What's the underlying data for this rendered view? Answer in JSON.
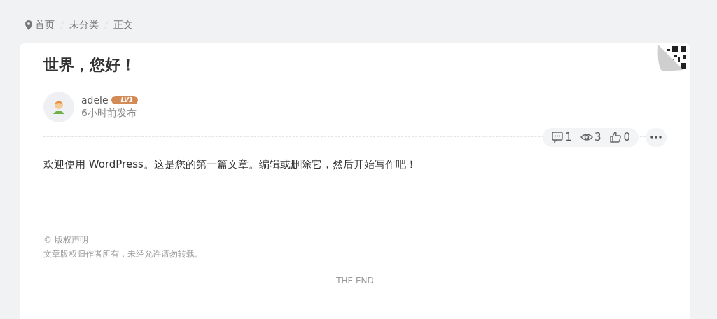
{
  "breadcrumb": [
    {
      "label": "首页"
    },
    {
      "label": "未分类"
    },
    {
      "label": "正文"
    }
  ],
  "post": {
    "title": "世界，您好！",
    "author": "adele",
    "level_badge": "LV1",
    "time": "6小时前发布",
    "stats": [
      {
        "kind": "comments",
        "count": "1"
      },
      {
        "kind": "views",
        "count": "3"
      },
      {
        "kind": "likes",
        "count": "0"
      }
    ],
    "content": "欢迎使用 WordPress。这是您的第一篇文章。编辑或删除它，然后开始写作吧！",
    "copyright_title": "© 版权声明",
    "copyright_text": "文章版权归作者所有，未经允许请勿转载。",
    "end_label": "THE END"
  }
}
